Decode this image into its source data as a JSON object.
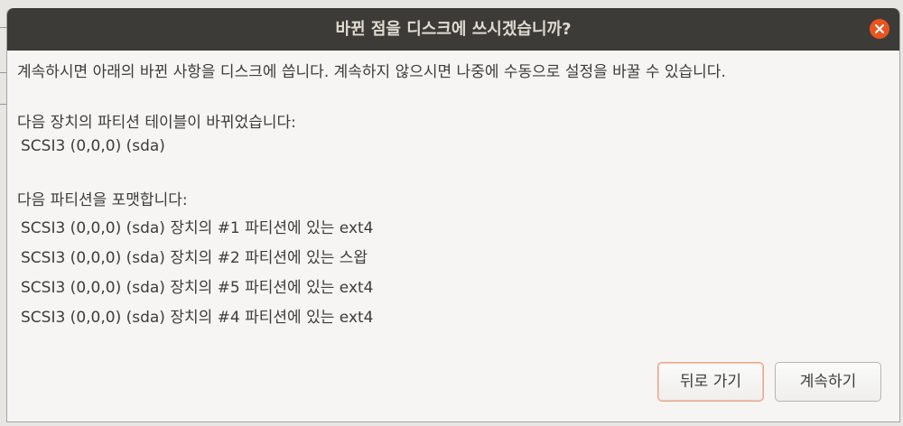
{
  "dialog": {
    "title": "바뀐 점을 디스크에 쓰시겠습니까?",
    "intro": "계속하시면 아래의 바뀐 사항을 디스크에 씁니다. 계속하지 않으시면 나중에 수동으로 설정을 바꿀 수 있습니다.",
    "partition_table_heading": "다음 장치의 파티션 테이블이 바뀌었습니다:",
    "partition_table_devices": [
      "SCSI3 (0,0,0) (sda)"
    ],
    "format_heading": "다음 파티션을 포맷합니다:",
    "format_partitions": [
      "SCSI3 (0,0,0) (sda) 장치의 #1 파티션에 있는 ext4",
      "SCSI3 (0,0,0) (sda) 장치의 #2 파티션에 있는 스왑",
      "SCSI3 (0,0,0) (sda) 장치의 #5 파티션에 있는 ext4",
      "SCSI3 (0,0,0) (sda) 장치의 #4 파티션에 있는 ext4"
    ],
    "buttons": {
      "back": "뒤로 가기",
      "continue": "계속하기"
    },
    "close_icon": "close-icon"
  },
  "colors": {
    "titlebar": "#3c3b37",
    "close_button": "#e95420",
    "dialog_background": "#f6f5f4",
    "focus_ring": "#e9a58a"
  }
}
